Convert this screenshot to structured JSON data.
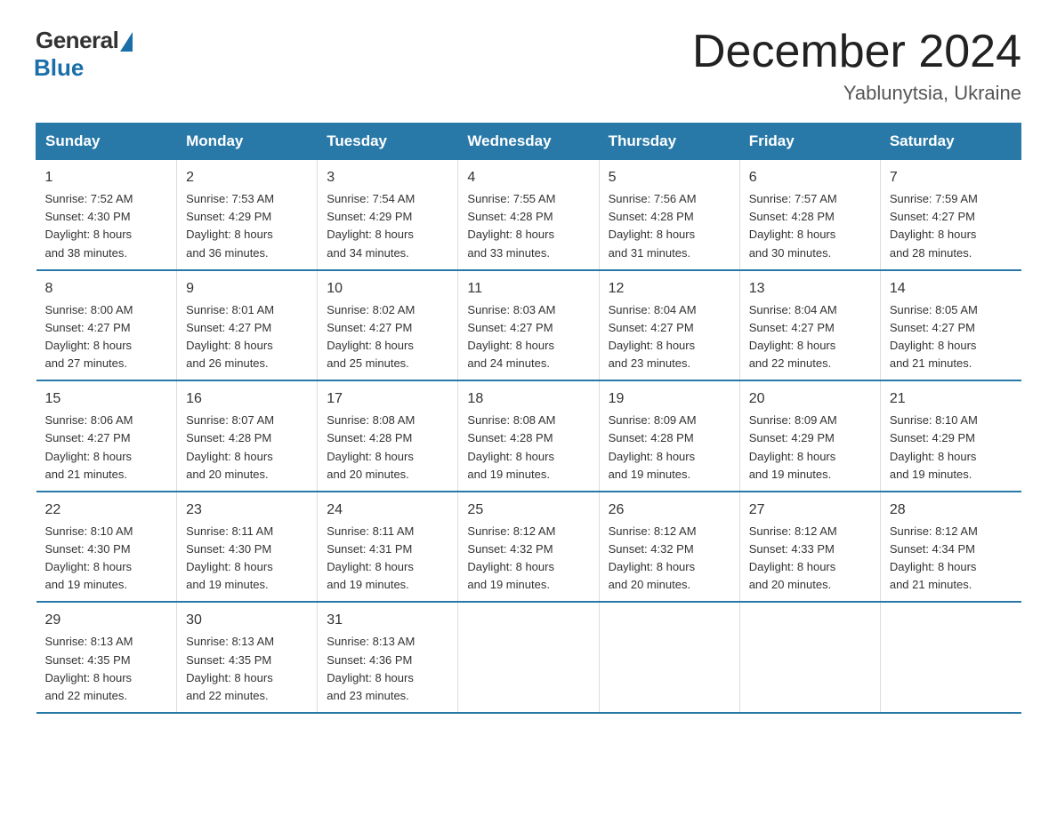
{
  "logo": {
    "general": "General",
    "blue": "Blue"
  },
  "title": "December 2024",
  "location": "Yablunytsia, Ukraine",
  "days_of_week": [
    "Sunday",
    "Monday",
    "Tuesday",
    "Wednesday",
    "Thursday",
    "Friday",
    "Saturday"
  ],
  "weeks": [
    [
      {
        "day": "1",
        "sunrise": "7:52 AM",
        "sunset": "4:30 PM",
        "daylight": "8 hours and 38 minutes."
      },
      {
        "day": "2",
        "sunrise": "7:53 AM",
        "sunset": "4:29 PM",
        "daylight": "8 hours and 36 minutes."
      },
      {
        "day": "3",
        "sunrise": "7:54 AM",
        "sunset": "4:29 PM",
        "daylight": "8 hours and 34 minutes."
      },
      {
        "day": "4",
        "sunrise": "7:55 AM",
        "sunset": "4:28 PM",
        "daylight": "8 hours and 33 minutes."
      },
      {
        "day": "5",
        "sunrise": "7:56 AM",
        "sunset": "4:28 PM",
        "daylight": "8 hours and 31 minutes."
      },
      {
        "day": "6",
        "sunrise": "7:57 AM",
        "sunset": "4:28 PM",
        "daylight": "8 hours and 30 minutes."
      },
      {
        "day": "7",
        "sunrise": "7:59 AM",
        "sunset": "4:27 PM",
        "daylight": "8 hours and 28 minutes."
      }
    ],
    [
      {
        "day": "8",
        "sunrise": "8:00 AM",
        "sunset": "4:27 PM",
        "daylight": "8 hours and 27 minutes."
      },
      {
        "day": "9",
        "sunrise": "8:01 AM",
        "sunset": "4:27 PM",
        "daylight": "8 hours and 26 minutes."
      },
      {
        "day": "10",
        "sunrise": "8:02 AM",
        "sunset": "4:27 PM",
        "daylight": "8 hours and 25 minutes."
      },
      {
        "day": "11",
        "sunrise": "8:03 AM",
        "sunset": "4:27 PM",
        "daylight": "8 hours and 24 minutes."
      },
      {
        "day": "12",
        "sunrise": "8:04 AM",
        "sunset": "4:27 PM",
        "daylight": "8 hours and 23 minutes."
      },
      {
        "day": "13",
        "sunrise": "8:04 AM",
        "sunset": "4:27 PM",
        "daylight": "8 hours and 22 minutes."
      },
      {
        "day": "14",
        "sunrise": "8:05 AM",
        "sunset": "4:27 PM",
        "daylight": "8 hours and 21 minutes."
      }
    ],
    [
      {
        "day": "15",
        "sunrise": "8:06 AM",
        "sunset": "4:27 PM",
        "daylight": "8 hours and 21 minutes."
      },
      {
        "day": "16",
        "sunrise": "8:07 AM",
        "sunset": "4:28 PM",
        "daylight": "8 hours and 20 minutes."
      },
      {
        "day": "17",
        "sunrise": "8:08 AM",
        "sunset": "4:28 PM",
        "daylight": "8 hours and 20 minutes."
      },
      {
        "day": "18",
        "sunrise": "8:08 AM",
        "sunset": "4:28 PM",
        "daylight": "8 hours and 19 minutes."
      },
      {
        "day": "19",
        "sunrise": "8:09 AM",
        "sunset": "4:28 PM",
        "daylight": "8 hours and 19 minutes."
      },
      {
        "day": "20",
        "sunrise": "8:09 AM",
        "sunset": "4:29 PM",
        "daylight": "8 hours and 19 minutes."
      },
      {
        "day": "21",
        "sunrise": "8:10 AM",
        "sunset": "4:29 PM",
        "daylight": "8 hours and 19 minutes."
      }
    ],
    [
      {
        "day": "22",
        "sunrise": "8:10 AM",
        "sunset": "4:30 PM",
        "daylight": "8 hours and 19 minutes."
      },
      {
        "day": "23",
        "sunrise": "8:11 AM",
        "sunset": "4:30 PM",
        "daylight": "8 hours and 19 minutes."
      },
      {
        "day": "24",
        "sunrise": "8:11 AM",
        "sunset": "4:31 PM",
        "daylight": "8 hours and 19 minutes."
      },
      {
        "day": "25",
        "sunrise": "8:12 AM",
        "sunset": "4:32 PM",
        "daylight": "8 hours and 19 minutes."
      },
      {
        "day": "26",
        "sunrise": "8:12 AM",
        "sunset": "4:32 PM",
        "daylight": "8 hours and 20 minutes."
      },
      {
        "day": "27",
        "sunrise": "8:12 AM",
        "sunset": "4:33 PM",
        "daylight": "8 hours and 20 minutes."
      },
      {
        "day": "28",
        "sunrise": "8:12 AM",
        "sunset": "4:34 PM",
        "daylight": "8 hours and 21 minutes."
      }
    ],
    [
      {
        "day": "29",
        "sunrise": "8:13 AM",
        "sunset": "4:35 PM",
        "daylight": "8 hours and 22 minutes."
      },
      {
        "day": "30",
        "sunrise": "8:13 AM",
        "sunset": "4:35 PM",
        "daylight": "8 hours and 22 minutes."
      },
      {
        "day": "31",
        "sunrise": "8:13 AM",
        "sunset": "4:36 PM",
        "daylight": "8 hours and 23 minutes."
      },
      {
        "day": "",
        "sunrise": "",
        "sunset": "",
        "daylight": ""
      },
      {
        "day": "",
        "sunrise": "",
        "sunset": "",
        "daylight": ""
      },
      {
        "day": "",
        "sunrise": "",
        "sunset": "",
        "daylight": ""
      },
      {
        "day": "",
        "sunrise": "",
        "sunset": "",
        "daylight": ""
      }
    ]
  ],
  "labels": {
    "sunrise": "Sunrise:",
    "sunset": "Sunset:",
    "daylight": "Daylight:"
  }
}
